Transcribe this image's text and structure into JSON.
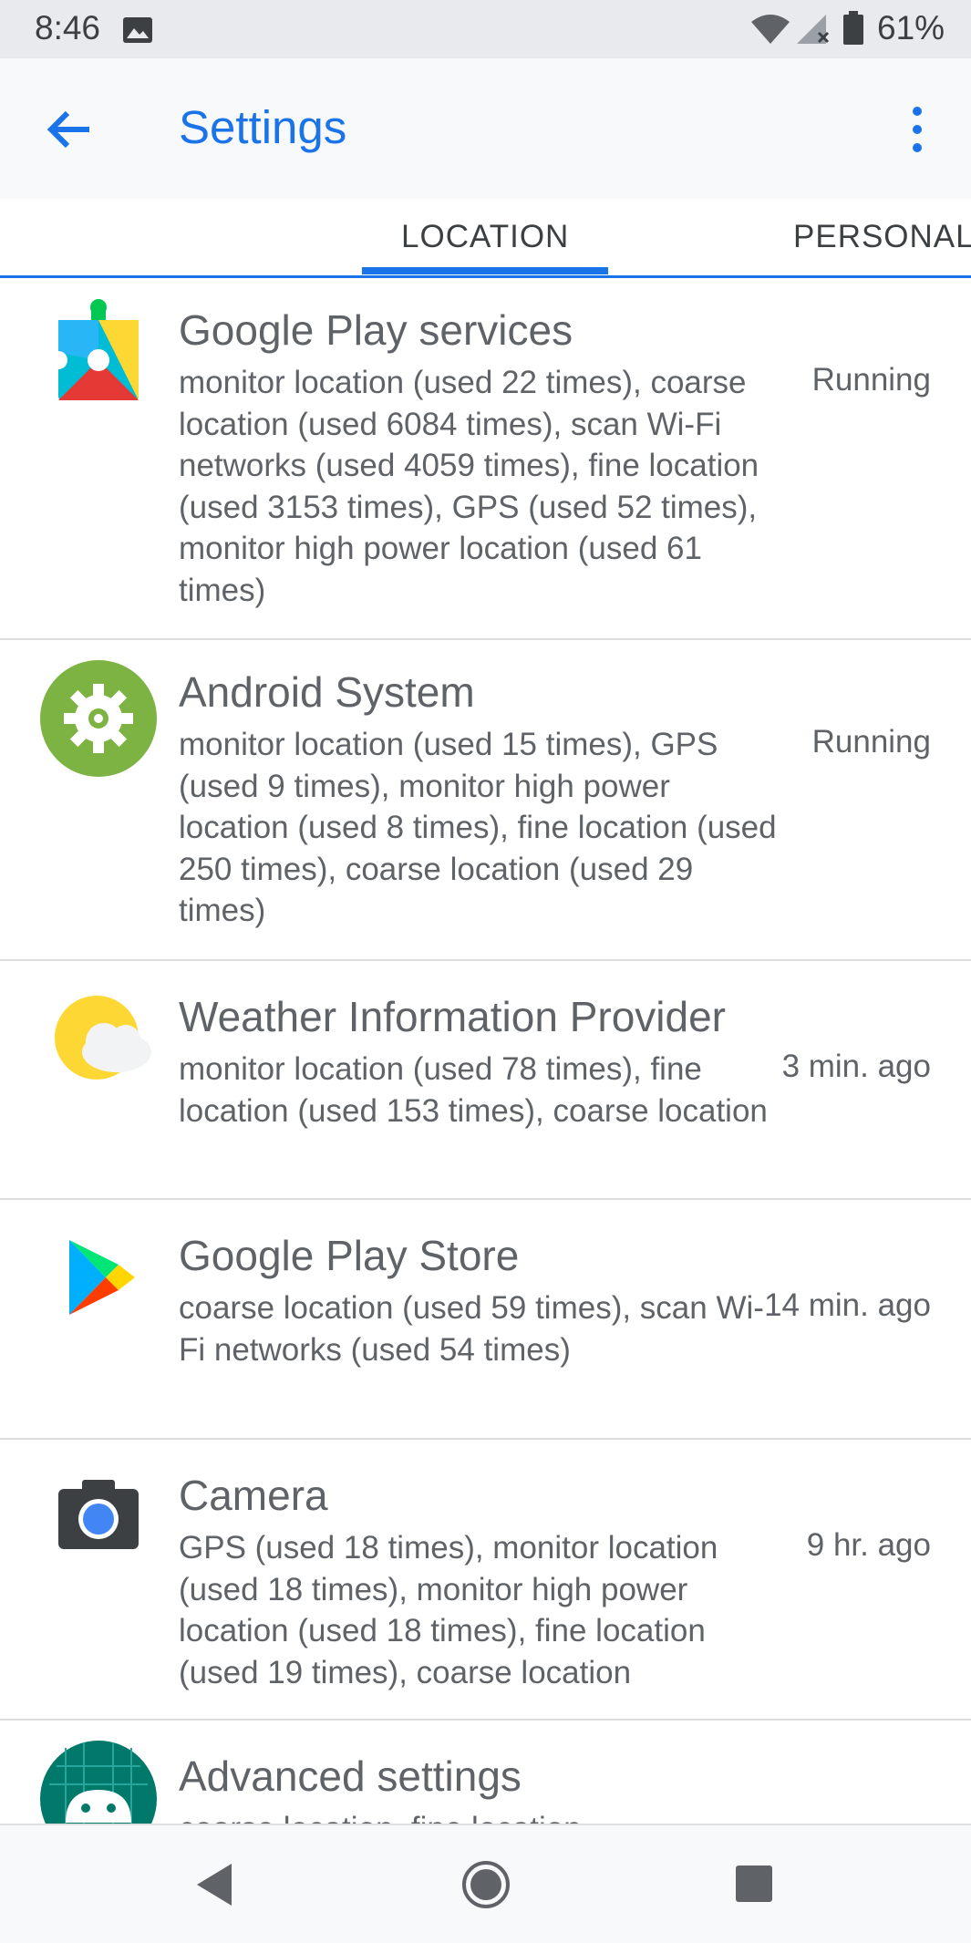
{
  "status_bar": {
    "time": "8:46",
    "battery_percent": "61%",
    "icons": [
      "image-icon",
      "wifi-icon",
      "signal-icon",
      "battery-icon"
    ]
  },
  "app_bar": {
    "title": "Settings",
    "back_icon": "arrow-back-icon",
    "menu_icon": "more-vert-icon"
  },
  "tabs": [
    {
      "label": "LOCATION",
      "selected": true
    },
    {
      "label": "PERSONAL",
      "selected": false
    }
  ],
  "apps": [
    {
      "name": "Google Play services",
      "summary": "monitor location (used 22 times), coarse location (used 6084 times), scan Wi-Fi networks (used 4059 times), fine location (used 3153 times), GPS (used 52 times), monitor high power location (used 61 times)",
      "status": "Running",
      "icon": "google-play-services-icon"
    },
    {
      "name": "Android System",
      "summary": "monitor location (used 15 times), GPS (used 9 times), monitor high power location (used 8 times), fine location (used 250 times), coarse location (used 29 times)",
      "status": "Running",
      "icon": "android-system-icon"
    },
    {
      "name": "Weather Information Provider",
      "summary": "monitor location (used 78 times), fine location (used 153 times), coarse location",
      "status": "3 min. ago",
      "icon": "weather-icon"
    },
    {
      "name": "Google Play Store",
      "summary": "coarse location (used 59 times), scan Wi-Fi networks (used 54 times)",
      "status": "14 min. ago",
      "icon": "play-store-icon"
    },
    {
      "name": "Camera",
      "summary": "GPS (used 18 times), monitor location (used 18 times), monitor high power location (used 18 times), fine location (used 19 times), coarse location",
      "status": "9 hr. ago",
      "icon": "camera-icon"
    },
    {
      "name": "Advanced settings",
      "summary": "coarse location, fine location",
      "status": "",
      "icon": "android-advanced-icon"
    }
  ],
  "nav_bar": {
    "icons": [
      "nav-back-icon",
      "nav-home-icon",
      "nav-recents-icon"
    ]
  },
  "colors": {
    "accent": "#1a73e8",
    "text_secondary": "#5f6368",
    "divider": "#dadce0"
  }
}
